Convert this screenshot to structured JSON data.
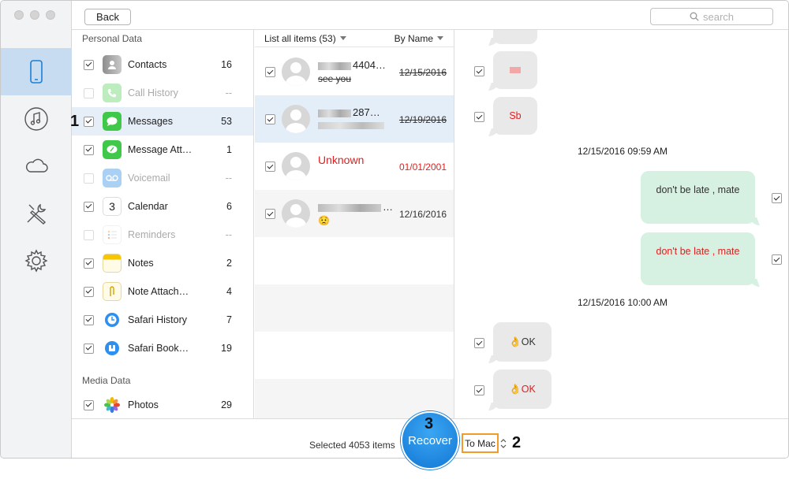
{
  "toolbar": {
    "back_label": "Back",
    "search_placeholder": "search"
  },
  "sections": {
    "personal": "Personal Data",
    "media": "Media Data"
  },
  "categories": [
    {
      "label": "Contacts",
      "count": "16",
      "checked": true,
      "enabled": true,
      "icon": "contacts-icon"
    },
    {
      "label": "Call History",
      "count": "--",
      "checked": false,
      "enabled": false,
      "icon": "phone-icon"
    },
    {
      "label": "Messages",
      "count": "53",
      "checked": true,
      "enabled": true,
      "icon": "messages-icon"
    },
    {
      "label": "Message Att…",
      "count": "1",
      "checked": true,
      "enabled": true,
      "icon": "message-attachment-icon"
    },
    {
      "label": "Voicemail",
      "count": "--",
      "checked": false,
      "enabled": false,
      "icon": "voicemail-icon"
    },
    {
      "label": "Calendar",
      "count": "6",
      "checked": true,
      "enabled": true,
      "icon": "calendar-icon"
    },
    {
      "label": "Reminders",
      "count": "--",
      "checked": false,
      "enabled": false,
      "icon": "reminders-icon"
    },
    {
      "label": "Notes",
      "count": "2",
      "checked": true,
      "enabled": true,
      "icon": "notes-icon"
    },
    {
      "label": "Note Attach…",
      "count": "4",
      "checked": true,
      "enabled": true,
      "icon": "note-attachment-icon"
    },
    {
      "label": "Safari History",
      "count": "7",
      "checked": true,
      "enabled": true,
      "icon": "safari-history-icon"
    },
    {
      "label": "Safari Book…",
      "count": "19",
      "checked": true,
      "enabled": true,
      "icon": "safari-bookmark-icon"
    },
    {
      "label": "Photos",
      "count": "29",
      "checked": true,
      "enabled": true,
      "icon": "photos-icon"
    }
  ],
  "calendar_day": "3",
  "threads_header": {
    "list_label": "List all items (53)",
    "sort_label": "By Name"
  },
  "threads": [
    {
      "name_visible": "4404…",
      "preview": "see you",
      "date": "12/15/2016",
      "deleted": true
    },
    {
      "name_visible": "287…",
      "preview": "",
      "date": "12/19/2016",
      "deleted": true
    },
    {
      "name_visible": "Unknown",
      "preview": "",
      "date": "01/01/2001",
      "deleted": false
    },
    {
      "name_visible": "…",
      "preview": "😟",
      "date": "12/16/2016",
      "deleted": false
    }
  ],
  "messages": {
    "sb_text": "Sb",
    "ts1": "12/15/2016 09:59 AM",
    "out1": "don't be late , mate",
    "out2": "don't be late , mate",
    "ts2": "12/15/2016 10:00 AM",
    "ok1": "👌OK",
    "ok2": "👌OK"
  },
  "bottom": {
    "selected_text": "Selected 4053 items",
    "recover_label": "Recover",
    "destination": "To Mac"
  },
  "annotations": {
    "step1": "1",
    "step2": "2",
    "step3": "3"
  },
  "colors": {
    "accent": "#1277d6",
    "deleted_red": "#e02020",
    "highlight_orange": "#f29b2a"
  }
}
